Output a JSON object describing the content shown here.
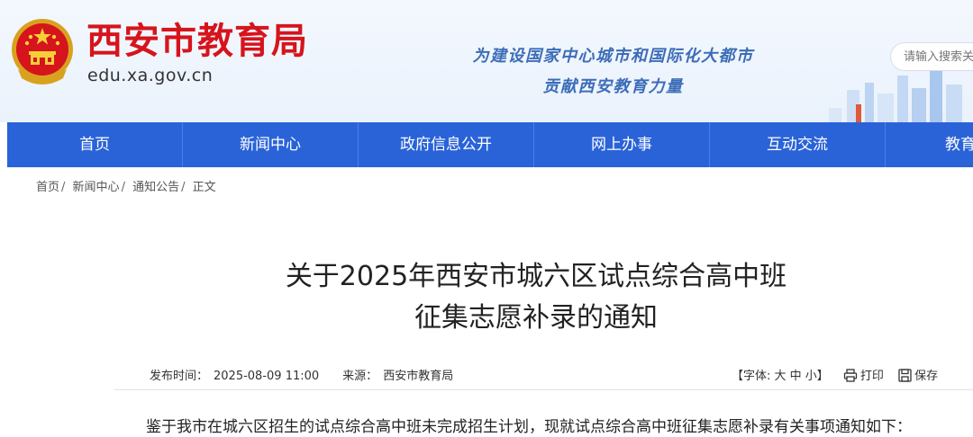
{
  "header": {
    "site_name": "西安市教育局",
    "site_url": "edu.xa.gov.cn",
    "slogan_line1": "为建设国家中心城市和国际化大都市",
    "slogan_line2": "贡献西安教育力量",
    "search_placeholder": "请输入搜索关键词"
  },
  "nav": {
    "items": [
      {
        "label": "首页"
      },
      {
        "label": "新闻中心"
      },
      {
        "label": "政府信息公开"
      },
      {
        "label": "网上办事"
      },
      {
        "label": "互动交流"
      },
      {
        "label": "教育"
      }
    ]
  },
  "breadcrumb": {
    "items": [
      "首页",
      "新闻中心",
      "通知公告",
      "正文"
    ],
    "separator": "/"
  },
  "article": {
    "title_line1": "关于2025年西安市城六区试点综合高中班",
    "title_line2": "征集志愿补录的通知",
    "publish_label": "发布时间：",
    "publish_time": "2025-08-09 11:00",
    "source_label": "来源：",
    "source": "西安市教育局",
    "font_size_label": "【字体: 大 中 小】",
    "print_label": "打印",
    "save_label": "保存",
    "first_paragraph": "鉴于我市在城六区招生的试点综合高中班未完成招生计划，现就试点综合高中班征集志愿补录有关事项通知如下："
  },
  "colors": {
    "brand_red": "#d6141c",
    "nav_blue": "#2a63d8",
    "slogan_blue": "#3c6db8"
  }
}
